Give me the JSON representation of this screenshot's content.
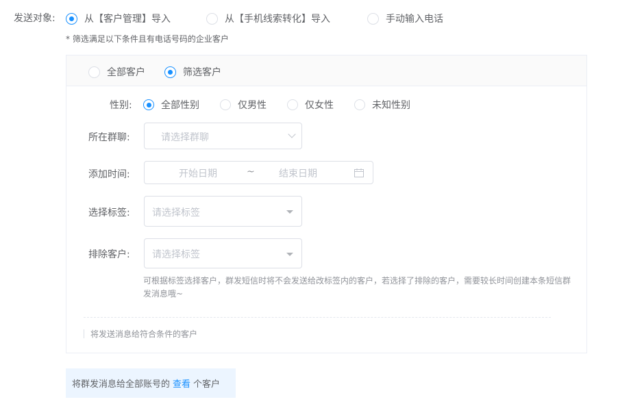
{
  "send_target": {
    "label": "发送对象:",
    "options": [
      {
        "label": "从【客户管理】导入",
        "selected": true
      },
      {
        "label": "从【手机线索转化】导入",
        "selected": false
      },
      {
        "label": "手动输入电话",
        "selected": false
      }
    ],
    "hint": "* 筛选满足以下条件且有电话号码的企业客户"
  },
  "scope": {
    "options": [
      {
        "label": "全部客户",
        "selected": false
      },
      {
        "label": "筛选客户",
        "selected": true
      }
    ]
  },
  "filters": {
    "gender": {
      "label": "性别:",
      "options": [
        {
          "label": "全部性别",
          "selected": true
        },
        {
          "label": "仅男性",
          "selected": false
        },
        {
          "label": "仅女性",
          "selected": false
        },
        {
          "label": "未知性别",
          "selected": false
        }
      ]
    },
    "group_chat": {
      "label": "所在群聊:",
      "placeholder": "请选择群聊",
      "icon": "chevron-down-icon"
    },
    "add_time": {
      "label": "添加时间:",
      "start_placeholder": "开始日期",
      "separator": "~",
      "end_placeholder": "结束日期",
      "icon": "calendar-icon"
    },
    "tags": {
      "label": "选择标签:",
      "placeholder": "请选择标签",
      "icon": "caret-down-icon"
    },
    "exclude": {
      "label": "排除客户:",
      "placeholder": "请选择标签",
      "icon": "caret-down-icon"
    },
    "exclude_hint": "可根据标签选择客户，群发短信时将不会发送给改标签内的客户，若选择了排除的客户，需要较长时间创建本条短信群发消息哦~"
  },
  "summary_text": "将发送消息给符合条件的客户",
  "footer": {
    "prefix": "将群发消息给全部账号的",
    "link": "查看",
    "suffix": "个客户",
    "bg_color": "#ecf5ff",
    "link_color": "#1890ff"
  }
}
